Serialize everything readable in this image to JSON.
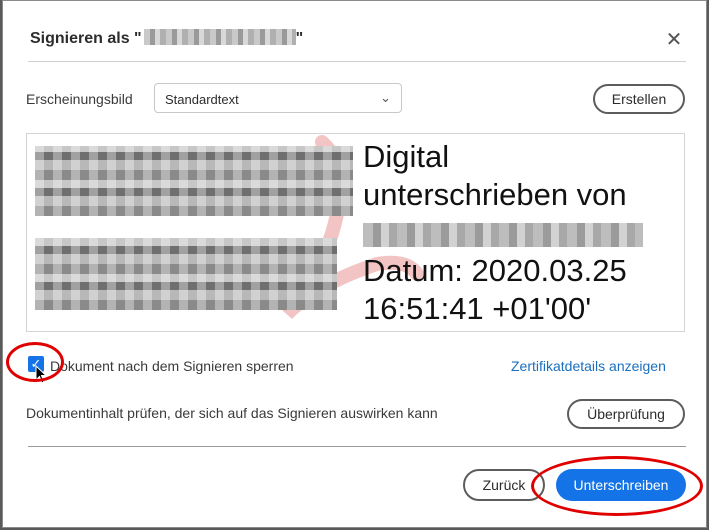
{
  "dialog": {
    "title_prefix": "Signieren als \"",
    "title_suffix": "\"",
    "close_glyph": "✕"
  },
  "appearance": {
    "label": "Erscheinungsbild",
    "selected": "Standardtext",
    "create_button": "Erstellen"
  },
  "preview": {
    "line1": "Digital",
    "line2": "unterschrieben von",
    "line3": "Datum: 2020.03.25",
    "line4": "16:51:41 +01'00'"
  },
  "options": {
    "lock_checked": true,
    "lock_label": "Dokument nach dem Signieren sperren",
    "cert_link": "Zertifikatdetails anzeigen",
    "review_text": "Dokumentinhalt prüfen, der sich auf das Signieren auswirken kann",
    "review_button": "Überprüfung"
  },
  "footer": {
    "back_button": "Zurück",
    "sign_button": "Unterschreiben"
  },
  "colors": {
    "accent": "#1473e6",
    "link": "#1a6fbf",
    "annotation": "#e00000"
  }
}
